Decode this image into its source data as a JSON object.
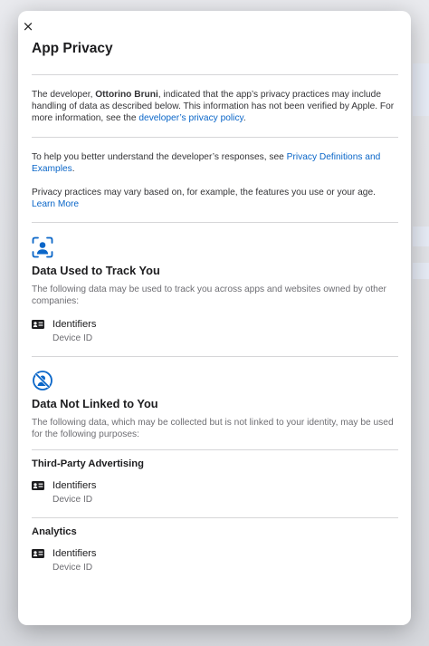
{
  "modal": {
    "close_label": "×",
    "title": "App Privacy",
    "intro": {
      "prefix": "The developer, ",
      "developer": "Ottorino Bruni",
      "middle": ", indicated that the app’s privacy practices may include handling of data as described below. This information has not been verified by Apple. For more information, see the ",
      "link": "developer’s privacy policy",
      "suffix": "."
    },
    "help": {
      "prefix": "To help you better understand the developer’s responses, see ",
      "link": "Privacy Definitions and Examples",
      "suffix": "."
    },
    "variance": {
      "text": "Privacy practices may vary based on, for example, the features you use or your age. ",
      "link": "Learn More"
    },
    "tracking": {
      "icon": "person-tracking-icon",
      "title": "Data Used to Track You",
      "description": "The following data may be used to track you across apps and websites owned by other companies:",
      "items": [
        {
          "icon": "id-card-icon",
          "title": "Identifiers",
          "sub": "Device ID"
        }
      ]
    },
    "not_linked": {
      "icon": "not-linked-icon",
      "title": "Data Not Linked to You",
      "description": "The following data, which may be collected but is not linked to your identity, may be used for the following purposes:",
      "groups": [
        {
          "title": "Third-Party Advertising",
          "items": [
            {
              "icon": "id-card-icon",
              "title": "Identifiers",
              "sub": "Device ID"
            }
          ]
        },
        {
          "title": "Analytics",
          "items": [
            {
              "icon": "id-card-icon",
              "title": "Identifiers",
              "sub": "Device ID"
            }
          ]
        }
      ]
    },
    "accent_color": "#0a66c8"
  }
}
